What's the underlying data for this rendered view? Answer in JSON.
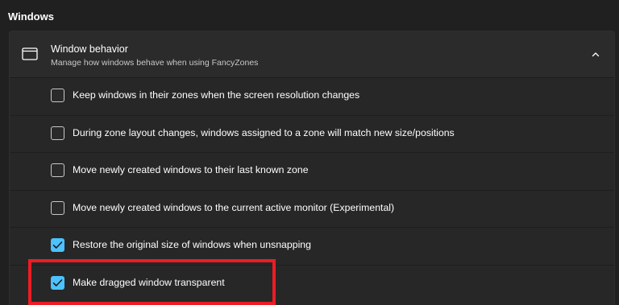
{
  "section": {
    "title": "Windows"
  },
  "card": {
    "title": "Window behavior",
    "description": "Manage how windows behave when using FancyZones",
    "icon": "window-icon",
    "expanded": true
  },
  "options": [
    {
      "label": "Keep windows in their zones when the screen resolution changes",
      "checked": false
    },
    {
      "label": "During zone layout changes, windows assigned to a zone will match new size/positions",
      "checked": false
    },
    {
      "label": "Move newly created windows to their last known zone",
      "checked": false
    },
    {
      "label": "Move newly created windows to the current active monitor (Experimental)",
      "checked": false
    },
    {
      "label": "Restore the original size of windows when unsnapping",
      "checked": true
    },
    {
      "label": "Make dragged window transparent",
      "checked": true
    }
  ],
  "colors": {
    "accent": "#4cc2ff",
    "highlight": "#ec1c24",
    "background": "#202020",
    "card": "#272727"
  }
}
